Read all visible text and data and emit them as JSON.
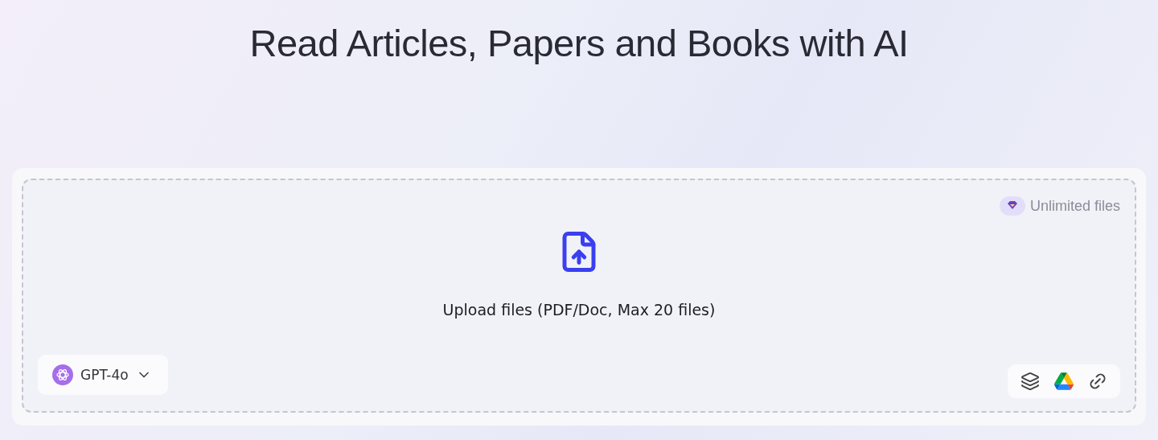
{
  "title": "Read Articles, Papers and Books with AI",
  "upload": {
    "badge": "Unlimited files",
    "prompt": "Upload files (PDF/Doc, Max 20 files)"
  },
  "model": {
    "label": "GPT-4o"
  },
  "sources": [
    {
      "kind": "layers"
    },
    {
      "kind": "drive"
    },
    {
      "kind": "link"
    }
  ]
}
